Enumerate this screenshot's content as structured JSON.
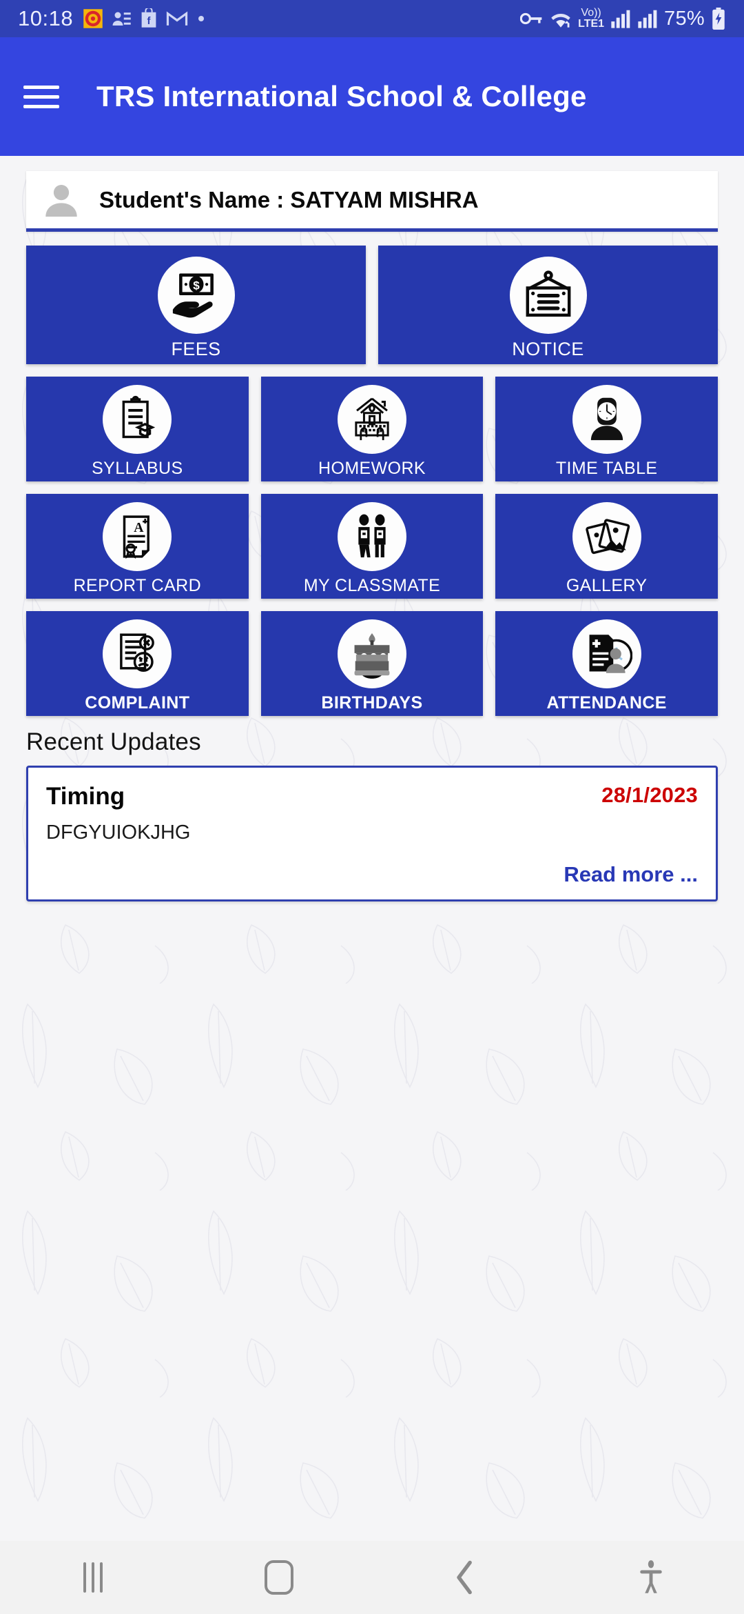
{
  "statusbar": {
    "time": "10:18",
    "battery": "75%",
    "network_label": "Vo)) LTE1",
    "icons": [
      "mandala-app-icon",
      "contacts-app-icon",
      "flipkart-app-icon",
      "gmail-icon",
      "dot-indicator",
      "vpn-key-icon",
      "wifi-icon",
      "volte-icon",
      "signal-bars-icon",
      "signal-bars-2-icon",
      "battery-charging-icon"
    ]
  },
  "appbar": {
    "menu_icon": "hamburger-menu-icon",
    "title": "TRS International School & College"
  },
  "student": {
    "avatar_icon": "person-avatar-icon",
    "label": "Student's Name : SATYAM MISHRA"
  },
  "grid": {
    "rows": [
      {
        "type": "two-up",
        "tiles": [
          {
            "label": "FEES",
            "icon": "money-in-hand-icon",
            "bold": false
          },
          {
            "label": "NOTICE",
            "icon": "hanging-notice-board-icon",
            "bold": false
          }
        ]
      },
      {
        "type": "three-up",
        "tiles": [
          {
            "label": "SYLLABUS",
            "icon": "clipboard-graduation-icon",
            "bold": false
          },
          {
            "label": "HOMEWORK",
            "icon": "house-keyboard-hands-icon",
            "bold": false
          },
          {
            "label": "TIME TABLE",
            "icon": "clock-person-icon",
            "bold": false
          }
        ]
      },
      {
        "type": "three-up",
        "tiles": [
          {
            "label": "REPORT CARD",
            "icon": "certificate-a-plus-icon",
            "bold": false
          },
          {
            "label": "MY CLASSMATE",
            "icon": "two-students-icon",
            "bold": false
          },
          {
            "label": "GALLERY",
            "icon": "photos-icon",
            "bold": false
          }
        ]
      },
      {
        "type": "three-up",
        "tiles": [
          {
            "label": "COMPLAINT",
            "icon": "document-angry-face-icon",
            "bold": true
          },
          {
            "label": "BIRTHDAYS",
            "icon": "birthday-cake-icon",
            "bold": true
          },
          {
            "label": "ATTENDANCE",
            "icon": "attendance-clipboard-clock-icon",
            "bold": true
          }
        ]
      }
    ]
  },
  "recent": {
    "section_title": "Recent Updates",
    "items": [
      {
        "title": "Timing",
        "date": "28/1/2023",
        "body": "DFGYUIOKJHG",
        "read_more": "Read more ..."
      }
    ]
  },
  "navbar": {
    "recents_icon": "recents-icon",
    "home_icon": "home-icon",
    "back_icon": "back-icon",
    "accessibility_icon": "accessibility-icon"
  },
  "colors": {
    "statusbar_bg": "#2f41b4",
    "appbar_bg": "#3445e0",
    "tile_bg": "#2638ad",
    "page_bg": "#f5f5f7",
    "accent_blue": "#2f3faf",
    "date_red": "#cc0000",
    "link_blue": "#2838b5"
  }
}
